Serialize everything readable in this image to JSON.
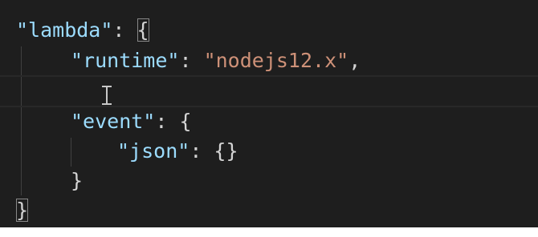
{
  "editor": {
    "lines": [
      {
        "key": "\"lambda\"",
        "sep": ": ",
        "open": "{"
      },
      {
        "key": "\"runtime\"",
        "sep": ": ",
        "value": "\"nodejs12.x\"",
        "trail": ","
      },
      {
        "empty": ""
      },
      {
        "key": "\"event\"",
        "sep": ": ",
        "open": "{"
      },
      {
        "key": "\"json\"",
        "sep": ": ",
        "value": "{}"
      },
      {
        "close": "}"
      },
      {
        "close": "}"
      }
    ]
  },
  "colors": {
    "background": "#1e1e1e",
    "key": "#9cdcfe",
    "string": "#ce9178",
    "punctuation": "#d4d4d4"
  },
  "cursor_icon": "text-cursor-ibeam-icon"
}
